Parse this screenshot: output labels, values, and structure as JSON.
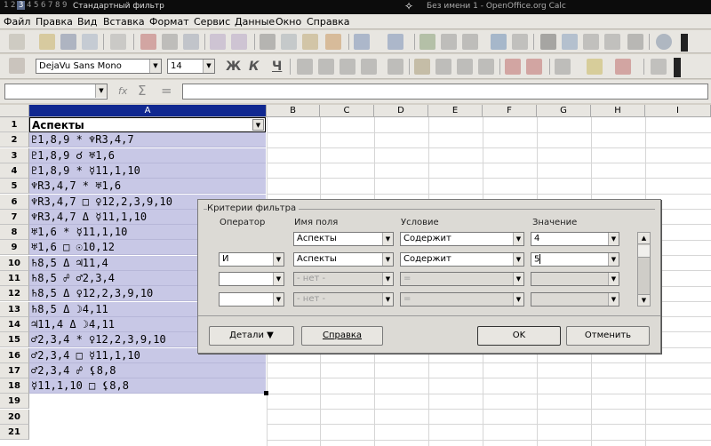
{
  "titlebar": {
    "workspaces": [
      "1",
      "2",
      "3",
      "4",
      "5",
      "6",
      "7",
      "8",
      "9"
    ],
    "active_workspace": "3",
    "dialog_title": "Стандартный фильтр",
    "app_title": "Без имени 1 - OpenOffice.org Calc"
  },
  "menu": [
    "Файл",
    "Правка",
    "Вид",
    "Вставка",
    "Формат",
    "Сервис",
    "Данные",
    "Окно",
    "Справка"
  ],
  "formatting": {
    "font_name": "DejaVu Sans Mono",
    "font_size": "14",
    "bold": "Ж",
    "italic": "К",
    "underline": "Ч"
  },
  "formula": {
    "name_box": "",
    "content": "",
    "fx": "fx",
    "sum": "Σ",
    "equals": "="
  },
  "columns": [
    "A",
    "B",
    "C",
    "D",
    "E",
    "F",
    "G",
    "H",
    "I"
  ],
  "rows": [
    "1",
    "2",
    "3",
    "4",
    "5",
    "6",
    "7",
    "8",
    "9",
    "10",
    "11",
    "12",
    "13",
    "14",
    "15",
    "16",
    "17",
    "18",
    "19",
    "20",
    "21"
  ],
  "cells_A": [
    "Аспекты",
    "♇1,8,9 * ♆R3,4,7",
    "♇1,8,9 ☌ ♅1,6",
    "♇1,8,9 * ☿11,1,10",
    "♆R3,4,7 * ♅1,6",
    "♆R3,4,7 □ ♀12,2,3,9,10",
    "♆R3,4,7 Δ ☿11,1,10",
    "♅1,6 * ☿11,1,10",
    "♅1,6 □ ☉10,12",
    "♄8,5 Δ ♃11,4",
    "♄8,5 ☍ ♂2,3,4",
    "♄8,5 Δ ♀12,2,3,9,10",
    "♄8,5 Δ ☽4,11",
    "♃11,4 Δ ☽4,11",
    "♂2,3,4 * ♀12,2,3,9,10",
    "♂2,3,4 □ ☿11,1,10",
    "♂2,3,4 ☍ ⚸8,8",
    "☿11,1,10 □ ⚸8,8"
  ],
  "dialog": {
    "group": "Критерии фильтра",
    "headers": {
      "operator": "Оператор",
      "field": "Имя поля",
      "condition": "Условие",
      "value": "Значение"
    },
    "rows": [
      {
        "operator": "",
        "field": "Аспекты",
        "condition": "Содержит",
        "value": "4"
      },
      {
        "operator": "И",
        "field": "Аспекты",
        "condition": "Содержит",
        "value": "5"
      },
      {
        "operator": "",
        "field": "- нет -",
        "condition": "=",
        "value": ""
      },
      {
        "operator": "",
        "field": "- нет -",
        "condition": "=",
        "value": ""
      }
    ],
    "buttons": {
      "details": "Детали",
      "help": "Справка",
      "ok": "OK",
      "cancel": "Отменить"
    }
  }
}
